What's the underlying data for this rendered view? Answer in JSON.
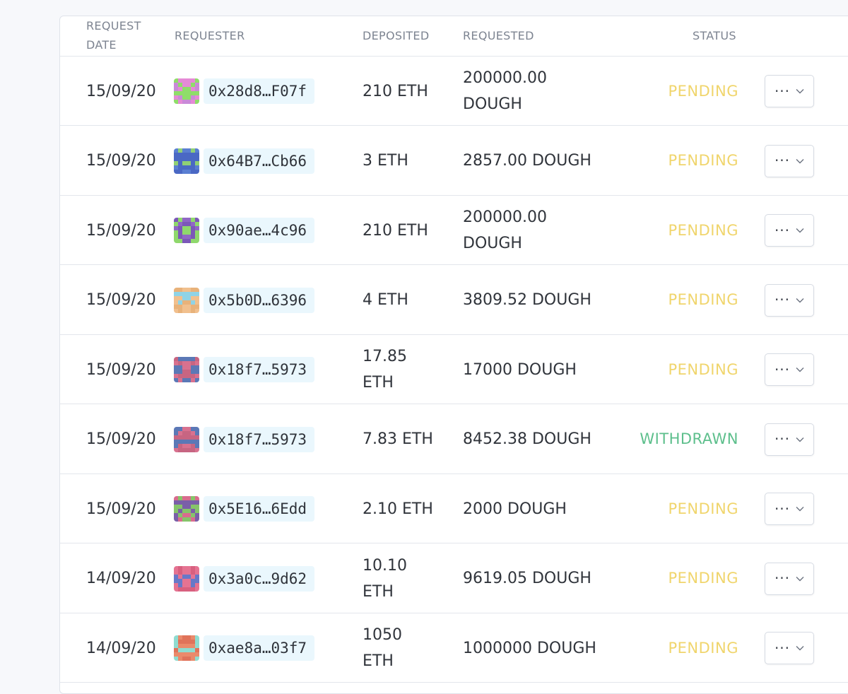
{
  "header": {
    "request_date": "REQUEST DATE",
    "requester": "REQUESTER",
    "deposited": "DEPOSITED",
    "requested": "REQUESTED",
    "status": "STATUS"
  },
  "status_colors": {
    "PENDING": "#f0d56c",
    "WITHDRAWN": "#5dbf8c"
  },
  "rows": [
    {
      "date": "15/09/20",
      "address": "0x28d8…F07f",
      "deposited": "210 ETH",
      "requested": "200000.00 DOUGH",
      "status": "PENDING",
      "avatar_colors": [
        "#e58ad6",
        "#8fdd6a",
        "#c98ad8"
      ]
    },
    {
      "date": "15/09/20",
      "address": "0x64B7…Cb66",
      "deposited": "3 ETH",
      "requested": "2857.00 DOUGH",
      "status": "PENDING",
      "avatar_colors": [
        "#5a7fd2",
        "#8fcf75",
        "#4a68c4"
      ]
    },
    {
      "date": "15/09/20",
      "address": "0x90ae…4c96",
      "deposited": "210 ETH",
      "requested": "200000.00 DOUGH",
      "status": "PENDING",
      "avatar_colors": [
        "#9067c6",
        "#8fd86c",
        "#7c58b8"
      ]
    },
    {
      "date": "15/09/20",
      "address": "0x5b0D…6396",
      "deposited": "4 ETH",
      "requested": "3809.52 DOUGH",
      "status": "PENDING",
      "avatar_colors": [
        "#f1c08e",
        "#8fd3e6",
        "#e8b27a"
      ]
    },
    {
      "date": "15/09/20",
      "address": "0x18f7…5973",
      "deposited": "17.85 ETH",
      "requested": "17000 DOUGH",
      "status": "PENDING",
      "avatar_colors": [
        "#d8718f",
        "#5b78b6",
        "#c76582"
      ]
    },
    {
      "date": "15/09/20",
      "address": "0x18f7…5973",
      "deposited": "7.83 ETH",
      "requested": "8452.38 DOUGH",
      "status": "WITHDRAWN",
      "avatar_colors": [
        "#d8718f",
        "#5b78b6",
        "#c76582"
      ]
    },
    {
      "date": "15/09/20",
      "address": "0x5E16…6Edd",
      "deposited": "2.10 ETH",
      "requested": "2000 DOUGH",
      "status": "PENDING",
      "avatar_colors": [
        "#d96c8e",
        "#86c46a",
        "#7a5fa8"
      ]
    },
    {
      "date": "14/09/20",
      "address": "0x3a0c…9d62",
      "deposited": "10.10 ETH",
      "requested": "9619.05 DOUGH",
      "status": "PENDING",
      "avatar_colors": [
        "#e57392",
        "#6878c8",
        "#d8607f"
      ]
    },
    {
      "date": "14/09/20",
      "address": "0xae8a…03f7",
      "deposited": "1050 ETH",
      "requested": "1000000 DOUGH",
      "status": "PENDING",
      "avatar_colors": [
        "#ea8a6b",
        "#8fdcd0",
        "#e0735a"
      ]
    }
  ]
}
